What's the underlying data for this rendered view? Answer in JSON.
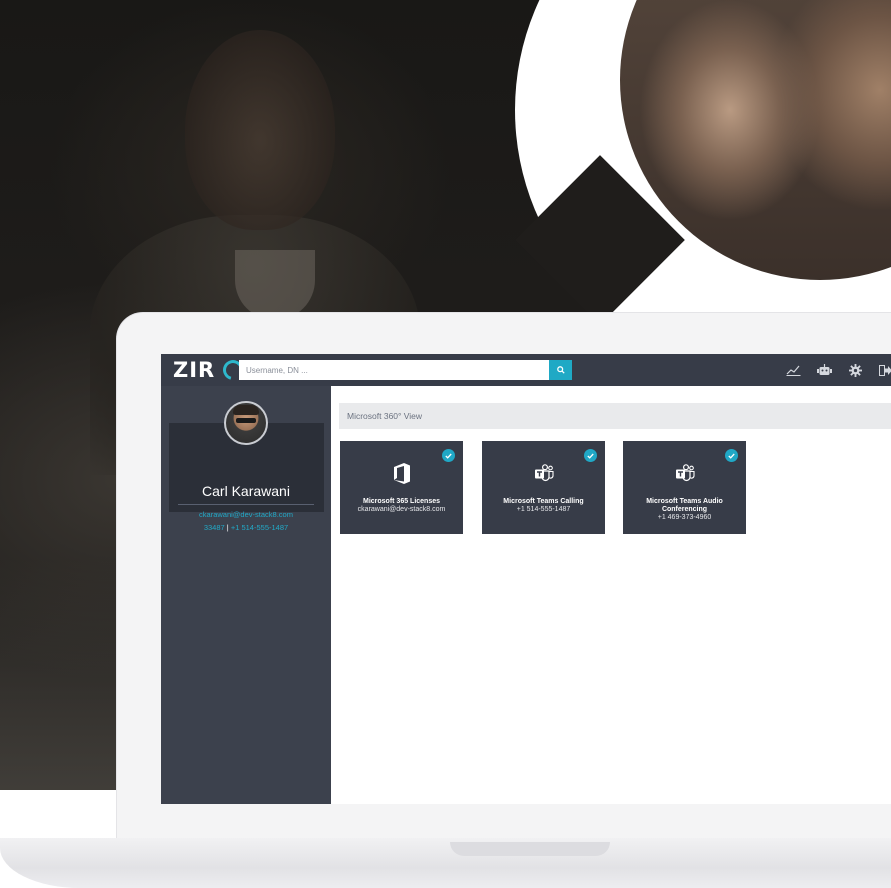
{
  "app": {
    "logo_text": "ZIR",
    "search": {
      "placeholder": "Username, DN ..."
    },
    "top_icons": [
      "chart-line-icon",
      "robot-icon",
      "gear-icon",
      "logout-icon"
    ]
  },
  "profile": {
    "name": "Carl Karawani",
    "email": "ckarawani@dev-stack8.com",
    "extension": "33487",
    "separator": "|",
    "phone": "+1 514-555-1487"
  },
  "main": {
    "view_title": "Microsoft 360° View",
    "tiles": [
      {
        "title": "Microsoft 365 Licenses",
        "subtitle": "ckarawani@dev-stack8.com",
        "icon": "office-icon",
        "status": "active"
      },
      {
        "title": "Microsoft Teams Calling",
        "subtitle": "+1 514-555-1487",
        "icon": "teams-icon",
        "status": "active"
      },
      {
        "title_line1": "Microsoft Teams Audio",
        "title_line2": "Conferencing",
        "subtitle": "+1 469-373-4960",
        "icon": "teams-icon",
        "status": "active"
      }
    ]
  },
  "colors": {
    "accent": "#1fa9c5",
    "brand_teal": "#2ec5cf",
    "topbar": "#373c48",
    "sidebar": "#3c414d"
  }
}
